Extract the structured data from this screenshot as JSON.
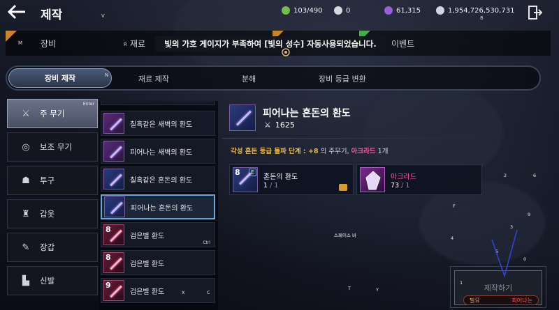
{
  "header": {
    "title": "제작",
    "resources": [
      {
        "icon": "green-gem-icon",
        "value": "103/490",
        "color": "#6fbf4a"
      },
      {
        "icon": "silver-orb-icon",
        "value": "0",
        "color": "#d8d8e0"
      },
      {
        "icon": "purple-crystal-icon",
        "value": "61,315",
        "color": "#9b5ce0"
      },
      {
        "icon": "silver-coin-icon",
        "value": "1,954,726,530,731",
        "color": "#cfd8e8"
      }
    ]
  },
  "top_tabs": {
    "equipment": "장비",
    "materials": "재료",
    "event": "이벤트"
  },
  "notice": "빛의 가호 게이지가 부족하여 [빛의 성수] 자동사용되었습니다.",
  "sub_tabs": {
    "equip_craft": "장비 제작",
    "material_craft": "재료 제작",
    "disassemble": "분해",
    "grade_convert": "장비 등급 변환"
  },
  "categories": [
    {
      "label": "주 무기",
      "icon": "crossed-swords-icon"
    },
    {
      "label": "보조 무기",
      "icon": "shield-icon"
    },
    {
      "label": "투구",
      "icon": "helmet-icon"
    },
    {
      "label": "갑옷",
      "icon": "armor-icon"
    },
    {
      "label": "장갑",
      "icon": "gauntlet-icon"
    },
    {
      "label": "신발",
      "icon": "boot-icon"
    }
  ],
  "items": [
    {
      "name": "칠흑같은 새벽의 환도",
      "tier": "",
      "style": "purple"
    },
    {
      "name": "피어나는 새벽의 환도",
      "tier": "",
      "style": "purple"
    },
    {
      "name": "칠흑같은 혼돈의 환도",
      "tier": "",
      "style": "blue"
    },
    {
      "name": "피어나는 혼돈의 환도",
      "tier": "",
      "style": "blue"
    },
    {
      "name": "검은별 환도",
      "tier": "8",
      "style": "red"
    },
    {
      "name": "검은별 환도",
      "tier": "8",
      "style": "red"
    },
    {
      "name": "검은별 환도",
      "tier": "9",
      "style": "red"
    }
  ],
  "detail": {
    "name": "피어나는 혼돈의 환도",
    "power": "1625",
    "requirement_prefix": "각성 혼돈 등급 돌파 단계 : ",
    "requirement_stage": "+8",
    "requirement_middle": " 의 주무기, ",
    "requirement_material": "아크라드",
    "requirement_suffix": " 1개",
    "materials": [
      {
        "name": "혼돈의 환도",
        "count": "1",
        "need": "1",
        "tier": "8",
        "badge": "E"
      },
      {
        "name": "아크라드",
        "count": "73",
        "need": "1"
      }
    ]
  },
  "craft": {
    "button": "제작하기",
    "need_label": "필요",
    "need_item": "피어나는"
  },
  "key_hints": {
    "v": "V",
    "m": "M",
    "r": "R",
    "n": "N",
    "enter": "Enter",
    "ctrl": "Ctrl",
    "x": "X",
    "c": "C",
    "t": "T",
    "y": "Y",
    "f": "F",
    "space": "스페이스 바",
    "k8": "8",
    "k2": "2",
    "k6": "6",
    "k9": "9",
    "k3": "3",
    "k4": "4",
    "k5": "5",
    "k0": "0",
    "k1": "1"
  }
}
